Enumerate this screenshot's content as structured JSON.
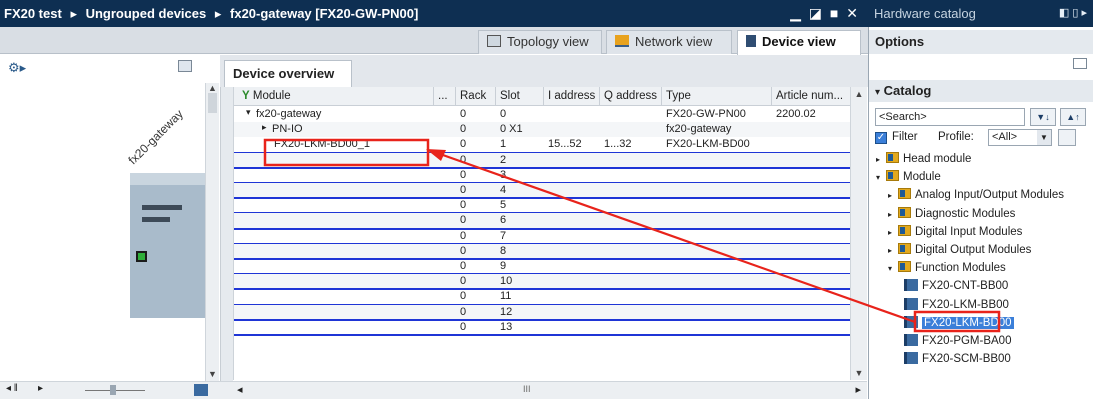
{
  "header": {
    "breadcrumb": [
      "FX20 test",
      "Ungrouped devices",
      "fx20-gateway [FX20-GW-PN00]"
    ],
    "separator": "▸",
    "window_controls": "▁ ◪ ■ ✕",
    "catalog_title": "Hardware catalog",
    "catalog_controls": "◧ ▯ ▸"
  },
  "view_tabs": [
    {
      "label": "Topology view"
    },
    {
      "label": "Network view"
    },
    {
      "label": "Device view"
    }
  ],
  "graphic": {
    "device_label": "fx20-gateway"
  },
  "overview": {
    "tab_label": "Device overview",
    "columns": [
      "Module",
      "...",
      "Rack",
      "Slot",
      "I address",
      "Q address",
      "Type",
      "Article num..."
    ],
    "rows": [
      {
        "module": "fx20-gateway",
        "rack": "0",
        "slot": "0",
        "i_address": "",
        "q_address": "",
        "type": "FX20-GW-PN00",
        "article": "2200.02"
      },
      {
        "module": "PN-IO",
        "rack": "0",
        "slot": "0 X1",
        "i_address": "",
        "q_address": "",
        "type": "fx20-gateway",
        "article": ""
      },
      {
        "module": "FX20-LKM-BD00_1",
        "rack": "0",
        "slot": "1",
        "i_address": "15...52",
        "q_address": "1...32",
        "type": "FX20-LKM-BD00",
        "article": ""
      },
      {
        "module": "",
        "rack": "0",
        "slot": "2"
      },
      {
        "module": "",
        "rack": "0",
        "slot": "3"
      },
      {
        "module": "",
        "rack": "0",
        "slot": "4"
      },
      {
        "module": "",
        "rack": "0",
        "slot": "5"
      },
      {
        "module": "",
        "rack": "0",
        "slot": "6"
      },
      {
        "module": "",
        "rack": "0",
        "slot": "7"
      },
      {
        "module": "",
        "rack": "0",
        "slot": "8"
      },
      {
        "module": "",
        "rack": "0",
        "slot": "9"
      },
      {
        "module": "",
        "rack": "0",
        "slot": "10"
      },
      {
        "module": "",
        "rack": "0",
        "slot": "11"
      },
      {
        "module": "",
        "rack": "0",
        "slot": "12"
      },
      {
        "module": "",
        "rack": "0",
        "slot": "13"
      }
    ],
    "hscroll_thumb": "III"
  },
  "catalog": {
    "options_label": "Options",
    "catalog_label": "Catalog",
    "search_placeholder": "<Search>",
    "filter_label": "Filter",
    "profile_label": "Profile:",
    "profile_value": "<All>",
    "tree": [
      {
        "label": "Head module",
        "expanded": false
      },
      {
        "label": "Module",
        "expanded": true
      },
      {
        "label": "Analog Input/Output Modules",
        "expanded": false
      },
      {
        "label": "Diagnostic Modules",
        "expanded": false
      },
      {
        "label": "Digital Input Modules",
        "expanded": false
      },
      {
        "label": "Digital Output Modules",
        "expanded": false
      },
      {
        "label": "Function Modules",
        "expanded": true
      },
      {
        "label": "FX20-CNT-BB00"
      },
      {
        "label": "FX20-LKM-BB00"
      },
      {
        "label": "FX20-LKM-BD00",
        "selected": true
      },
      {
        "label": "FX20-PGM-BA00"
      },
      {
        "label": "FX20-SCM-BB00"
      }
    ]
  },
  "colors": {
    "title_bar": "#0e2f52",
    "highlight_red": "#e8231b",
    "slot_line_blue": "#1f35d6",
    "selected_blue": "#3b7fd9"
  }
}
